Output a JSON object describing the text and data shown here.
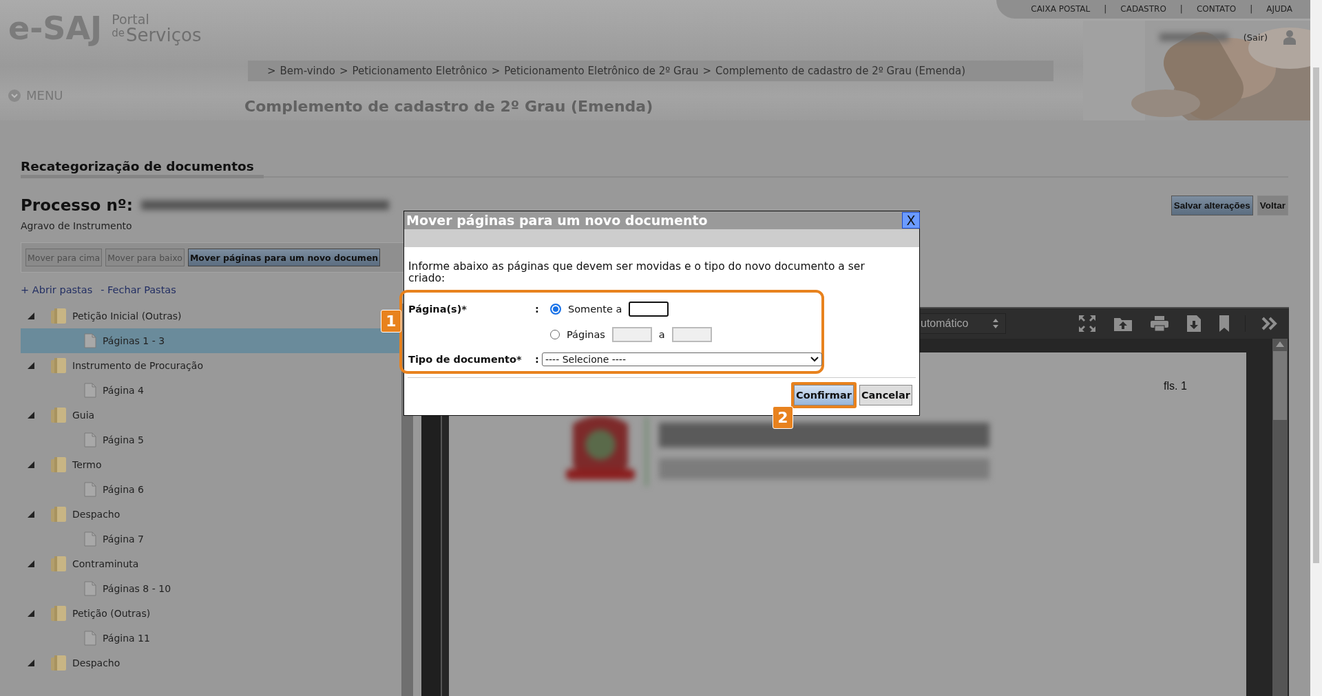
{
  "header": {
    "logo": {
      "name": "e-SAJ",
      "line_1": "Portal",
      "line_2_prefix": "de",
      "line_2": "Serviços"
    },
    "top_links": [
      "CAIXA POSTAL",
      "CADASTRO",
      "CONTATO",
      "AJUDA"
    ],
    "link_separator": "|",
    "logout": "(Sair)",
    "breadcrumb": {
      "separator": ">",
      "items": [
        "Bem-vindo",
        "Peticionamento Eletrônico",
        "Peticionamento Eletrônico de 2º Grau",
        "Complemento de cadastro de 2º Grau (Emenda)"
      ]
    },
    "menu": "MENU",
    "page_title": "Complemento de cadastro de 2º Grau (Emenda)"
  },
  "section_title": "Recategorização de documentos",
  "process": {
    "label": "Processo nº:",
    "type": "Agravo de Instrumento"
  },
  "actions": [
    {
      "label": "Salvar alterações",
      "kind": "primary"
    },
    {
      "label": "Voltar",
      "kind": "secondary"
    }
  ],
  "toolbar": [
    {
      "label": "Mover para cima",
      "disabled": true
    },
    {
      "label": "Mover para baixo",
      "disabled": true
    },
    {
      "label": "Mover páginas para um novo documen",
      "disabled": false
    }
  ],
  "folder_links": [
    "+ Abrir pastas",
    "- Fechar Pastas"
  ],
  "tree": [
    {
      "label": "Petição Inicial (Outras)",
      "expanded": true,
      "selected": false,
      "children": [
        {
          "label": "Páginas 1 - 3",
          "selected": true
        }
      ]
    },
    {
      "label": "Instrumento de Procuração",
      "expanded": true,
      "selected": false,
      "children": [
        {
          "label": "Página 4",
          "selected": false
        }
      ]
    },
    {
      "label": "Guia",
      "expanded": true,
      "selected": false,
      "children": [
        {
          "label": "Página 5",
          "selected": false
        }
      ]
    },
    {
      "label": "Termo",
      "expanded": true,
      "selected": false,
      "children": [
        {
          "label": "Página 6",
          "selected": false
        }
      ]
    },
    {
      "label": "Despacho",
      "expanded": true,
      "selected": false,
      "children": [
        {
          "label": "Página 7",
          "selected": false
        }
      ]
    },
    {
      "label": "Contraminuta",
      "expanded": true,
      "selected": false,
      "children": [
        {
          "label": "Páginas 8 - 10",
          "selected": false
        }
      ]
    },
    {
      "label": "Petição (Outras)",
      "expanded": true,
      "selected": false,
      "children": [
        {
          "label": "Página 11",
          "selected": false
        }
      ]
    },
    {
      "label": "Despacho",
      "expanded": true,
      "selected": false
    }
  ],
  "viewer": {
    "zoom": "utomático",
    "page_label": "fls. 1"
  },
  "dialog": {
    "title": "Mover páginas para um novo documento",
    "close": "X",
    "instructions": "Informe abaixo as páginas que devem ser movidas e o tipo do novo documento a ser criado:",
    "pages_label": "Página(s)*",
    "colon": ":",
    "options": [
      {
        "kind": "single",
        "label": "Somente a",
        "selected": true
      },
      {
        "kind": "range",
        "label": "Páginas",
        "joiner": "a",
        "selected": false
      }
    ],
    "doc_type": {
      "label": "Tipo de documento*",
      "colon": ":",
      "value": "---- Selecione ----"
    },
    "buttons": [
      {
        "label": "Confirmar",
        "highlighted": true
      },
      {
        "label": "Cancelar",
        "highlighted": false
      }
    ],
    "callouts": [
      {
        "number": "1"
      },
      {
        "number": "2"
      }
    ]
  }
}
